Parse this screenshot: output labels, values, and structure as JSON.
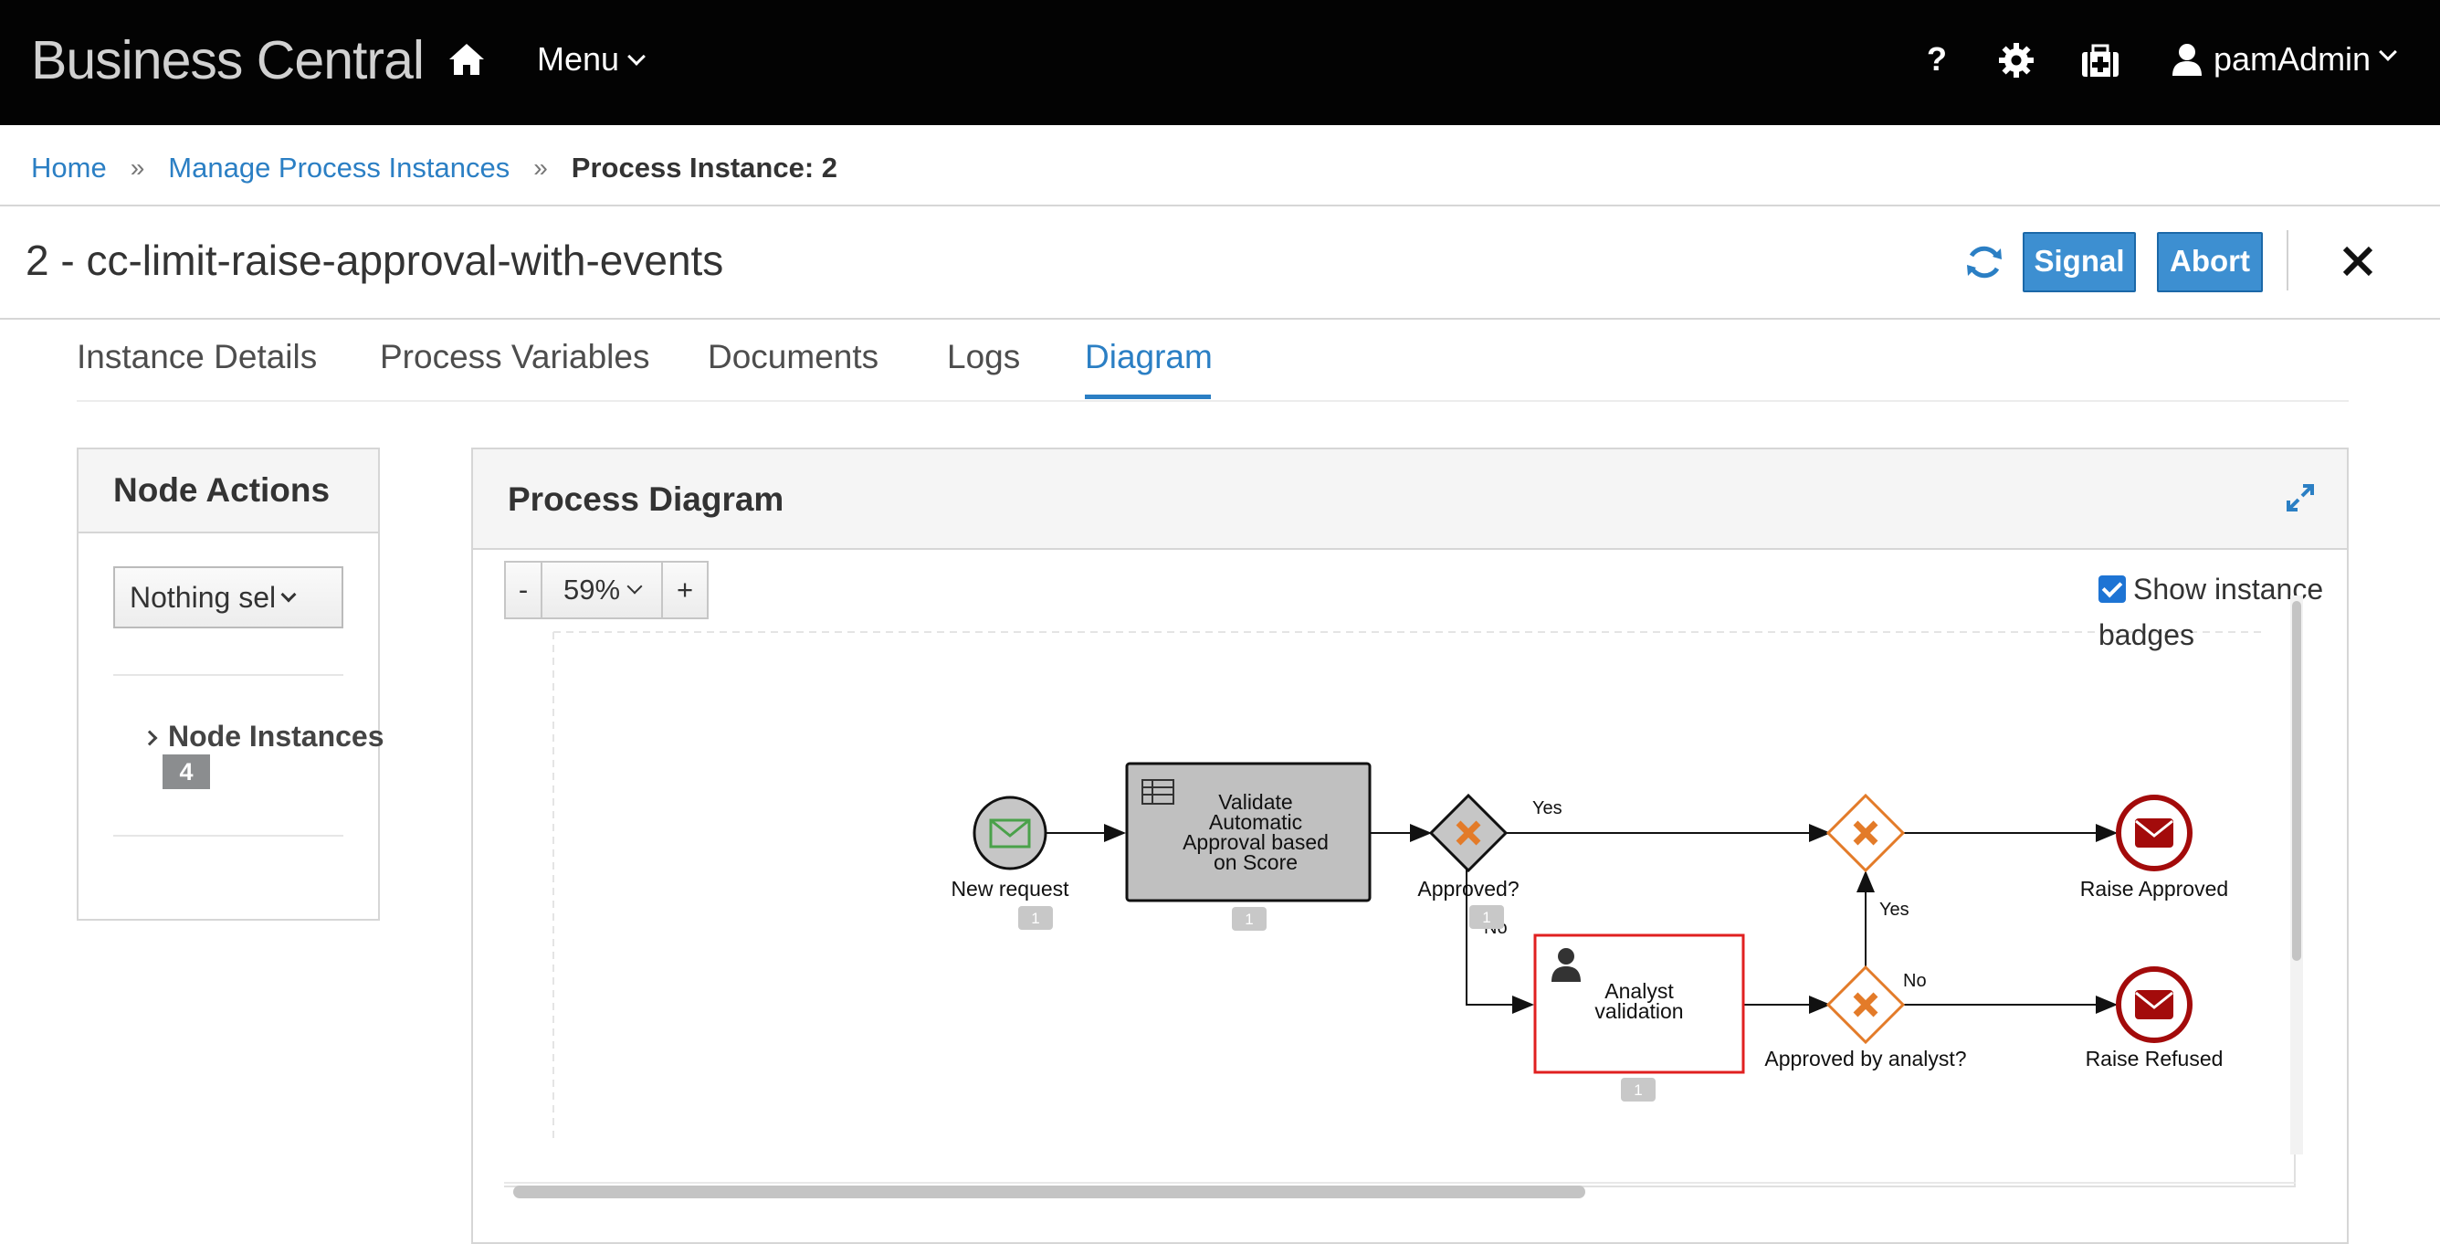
{
  "header": {
    "brand": "Business Central",
    "menu_label": "Menu",
    "help_label": "?",
    "user_name": "pamAdmin"
  },
  "breadcrumb": {
    "home": "Home",
    "manage": "Manage Process Instances",
    "current": "Process Instance: 2"
  },
  "instance": {
    "title": "2 - cc-limit-raise-approval-with-events",
    "signal_label": "Signal",
    "abort_label": "Abort"
  },
  "tabs": [
    {
      "label": "Instance Details"
    },
    {
      "label": "Process Variables"
    },
    {
      "label": "Documents"
    },
    {
      "label": "Logs"
    },
    {
      "label": "Diagram",
      "active": true
    }
  ],
  "node_actions": {
    "title": "Node Actions",
    "select_value": "Nothing sel",
    "node_instances_label": "Node Instances",
    "node_instances_count": "4"
  },
  "process_diagram": {
    "title": "Process Diagram",
    "zoom_minus": "-",
    "zoom_level": "59%",
    "zoom_plus": "+",
    "show_badges_label": "Show instance badges",
    "show_badges_checked": true,
    "nodes": {
      "start": {
        "label": "New request",
        "badge": "1"
      },
      "task1": {
        "label_lines": [
          "Validate",
          "Automatic",
          "Approval based",
          "on Score"
        ],
        "badge": "1"
      },
      "gw1": {
        "label": "Approved?",
        "badge": "1"
      },
      "task2": {
        "label_lines": [
          "Analyst",
          "validation"
        ],
        "badge": "1"
      },
      "gw2": {
        "label": "Approved by analyst?"
      },
      "end_approved": {
        "label": "Raise Approved"
      },
      "end_refused": {
        "label": "Raise Refused"
      }
    },
    "edges": {
      "yes_top": "Yes",
      "no_left": "No",
      "yes_right": "Yes",
      "no_right": "No"
    },
    "colors": {
      "gateway": "#e37b29",
      "end_event": "#a30b0b",
      "active_task_border": "#e02020",
      "completed_fill": "#c0c0c0",
      "accent": "#2b7fc4"
    }
  }
}
